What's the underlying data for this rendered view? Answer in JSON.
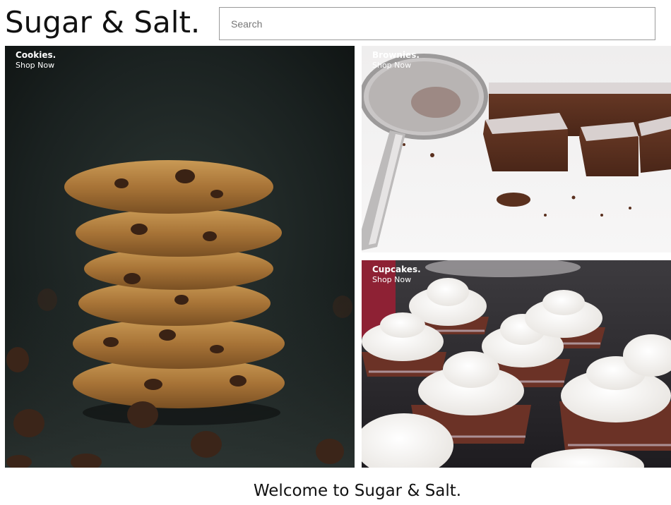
{
  "header": {
    "logo": "Sugar & Salt.",
    "search_placeholder": "Search"
  },
  "tiles": [
    {
      "title": "Cookies.",
      "link": "Shop Now"
    },
    {
      "title": "Brownies.",
      "link": "Shop Now"
    },
    {
      "title": "Cupcakes.",
      "link": "Shop Now"
    }
  ],
  "welcome": "Welcome to Sugar & Salt.",
  "colors": {
    "text": "#111111",
    "search_border": "#9a9a9a"
  }
}
